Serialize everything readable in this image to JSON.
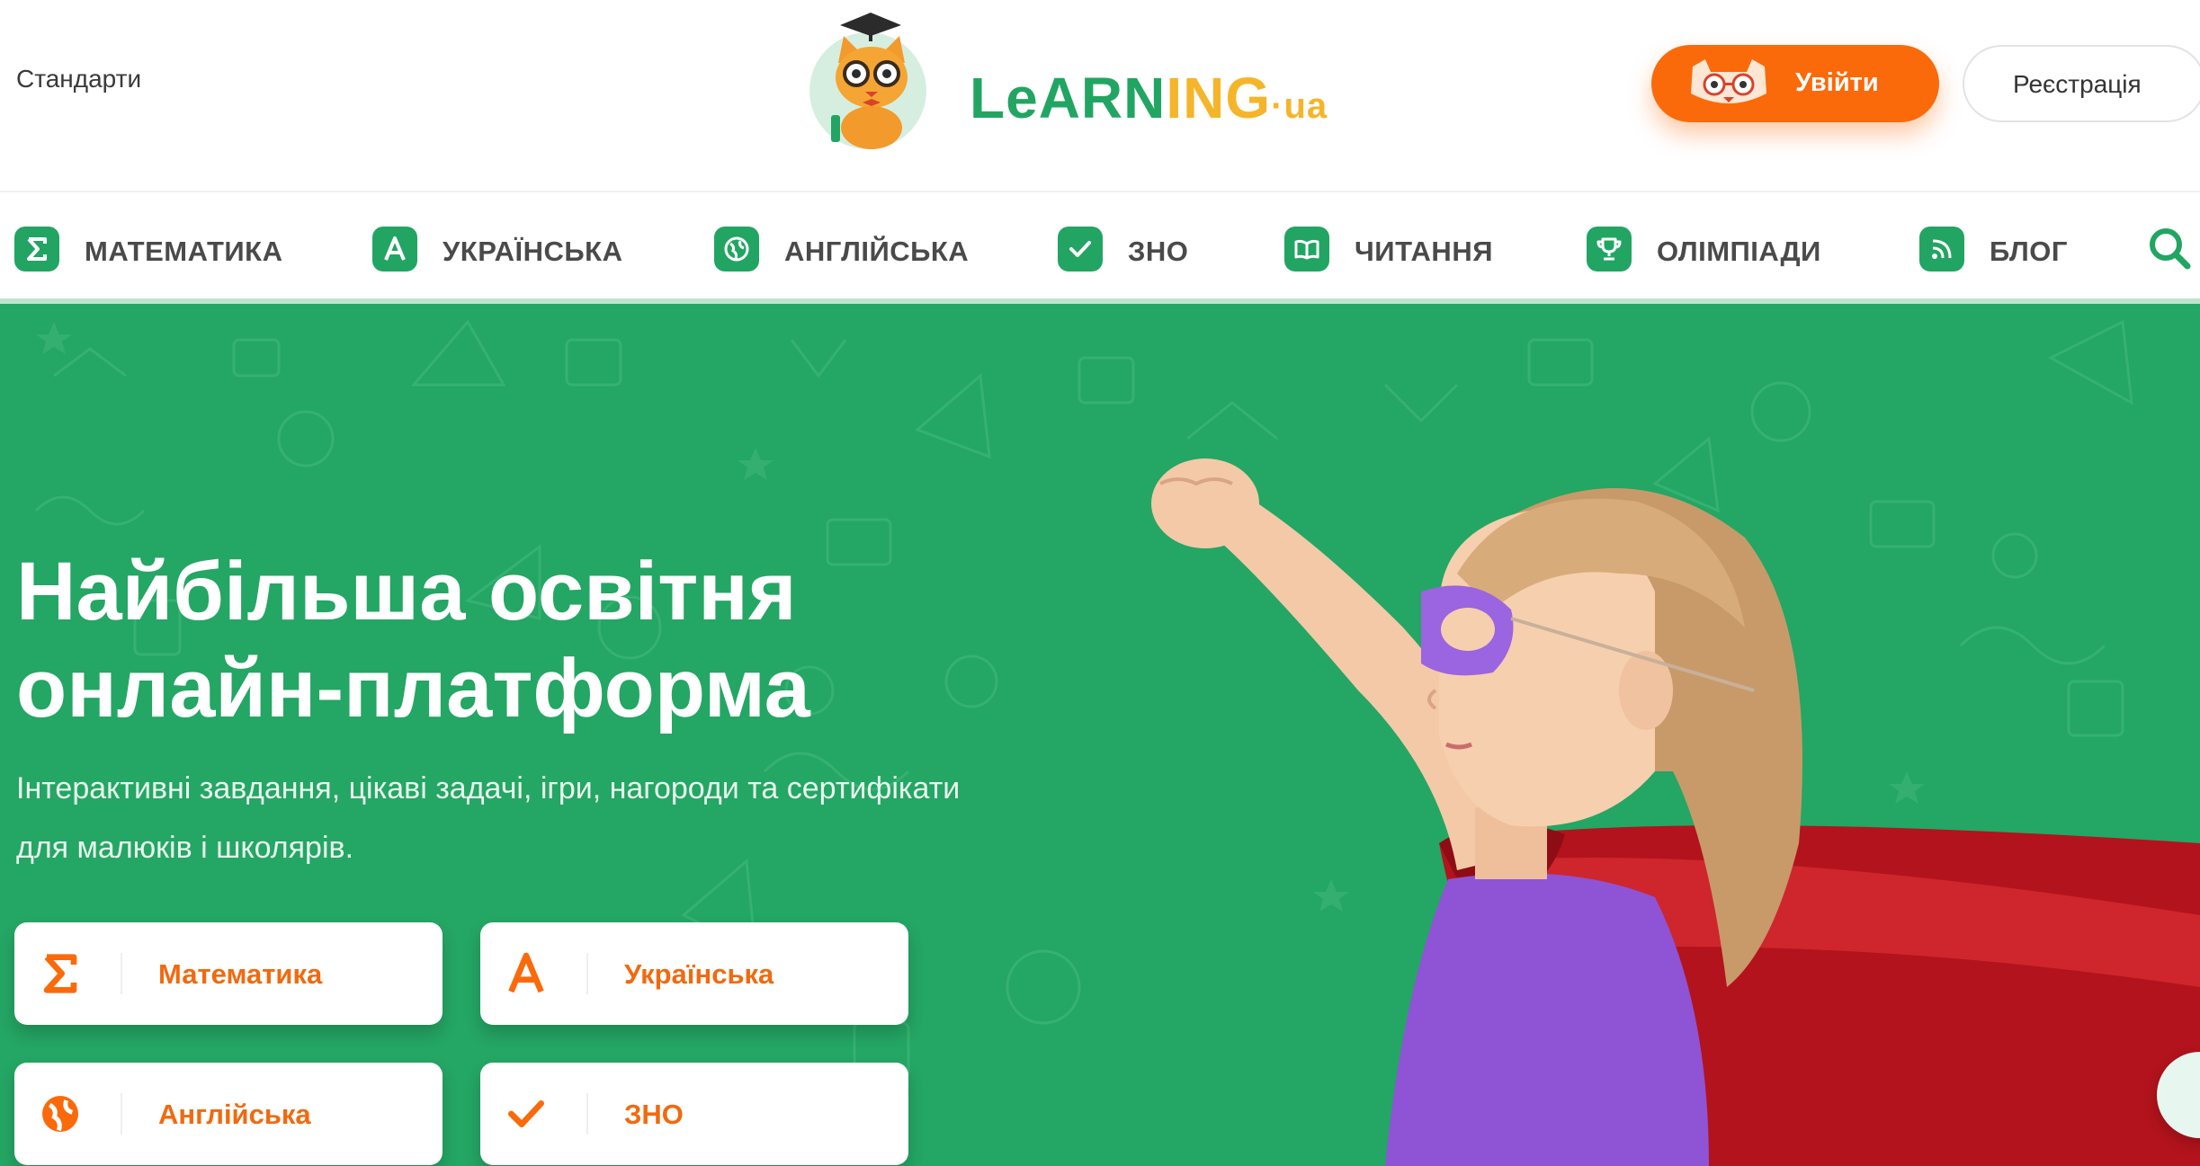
{
  "header": {
    "standards_link": "Стандарти",
    "logo_text_a": "LeARN",
    "logo_text_b": "ING",
    "logo_text_c": "·ua",
    "login_label": "Увійти",
    "register_label": "Реєстрація"
  },
  "nav": {
    "items": [
      {
        "label": "МАТЕМАТИКА",
        "icon": "sigma-icon"
      },
      {
        "label": "УКРАЇНСЬКА",
        "icon": "letter-a-icon"
      },
      {
        "label": "АНГЛІЙСЬКА",
        "icon": "globe-icon"
      },
      {
        "label": "ЗНО",
        "icon": "check-icon"
      },
      {
        "label": "ЧИТАННЯ",
        "icon": "book-icon"
      },
      {
        "label": "ОЛІМПІАДИ",
        "icon": "trophy-icon"
      },
      {
        "label": "БЛОГ",
        "icon": "rss-icon"
      }
    ],
    "search_icon": "search-icon"
  },
  "hero": {
    "title_line1": "Найбільша освітня",
    "title_line2": "онлайн-платформа",
    "subtitle_line1": "Інтерактивні завдання, цікаві задачі, ігри, нагороди та сертифікати",
    "subtitle_line2": "для малюків і школярів.",
    "cards": [
      {
        "label": "Математика",
        "icon": "sigma-icon"
      },
      {
        "label": "Українська",
        "icon": "letter-a-icon"
      },
      {
        "label": "Англійська",
        "icon": "globe-icon"
      },
      {
        "label": "ЗНО",
        "icon": "check-icon"
      }
    ]
  },
  "colors": {
    "brand_green": "#24a664",
    "accent_orange": "#fa6a0a",
    "nav_icon_green": "#22a563"
  }
}
